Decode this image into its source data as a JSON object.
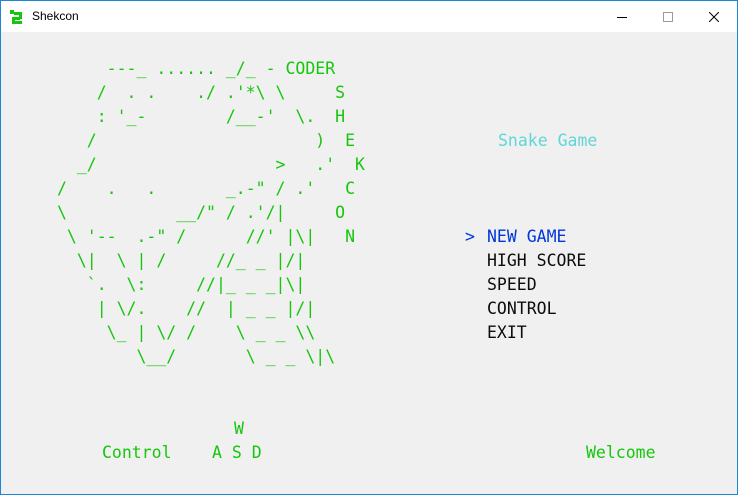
{
  "window": {
    "title": "Shekcon"
  },
  "art": [
    "     ---_ ...... _/_ - CODER",
    "    /  . .    ./ .'*\\ \\     S",
    "    : '_-        /__-'  \\.  H",
    "   /                      )  E",
    "  _/                  >   .'  K",
    "/    .   .       _.-\" / .'   C",
    "\\           __/\" / .'/|     O",
    " \\ '--  .-\" /      //' |\\|   N",
    "  \\|  \\ | /     //_ _ |/|",
    "   `.  \\:     //|_ _ _|\\|",
    "    | \\/.    //  | _ _ |/|",
    "     \\_ | \\/ /    \\ _ _ \\\\",
    "        \\__/       \\ _ _ \\|\\"
  ],
  "game_title": "Snake Game",
  "menu": {
    "cursor": ">",
    "items": [
      "NEW GAME",
      "HIGH SCORE",
      "SPEED",
      "CONTROL",
      "EXIT"
    ]
  },
  "footer": {
    "control_label": "Control",
    "key_up": "W",
    "keys_row": "A S D",
    "welcome": "Welcome"
  },
  "colors": {
    "art": "#16c60c",
    "title": "#61d6d6",
    "selected": "#0037da",
    "menu": "#0c0c0c"
  }
}
